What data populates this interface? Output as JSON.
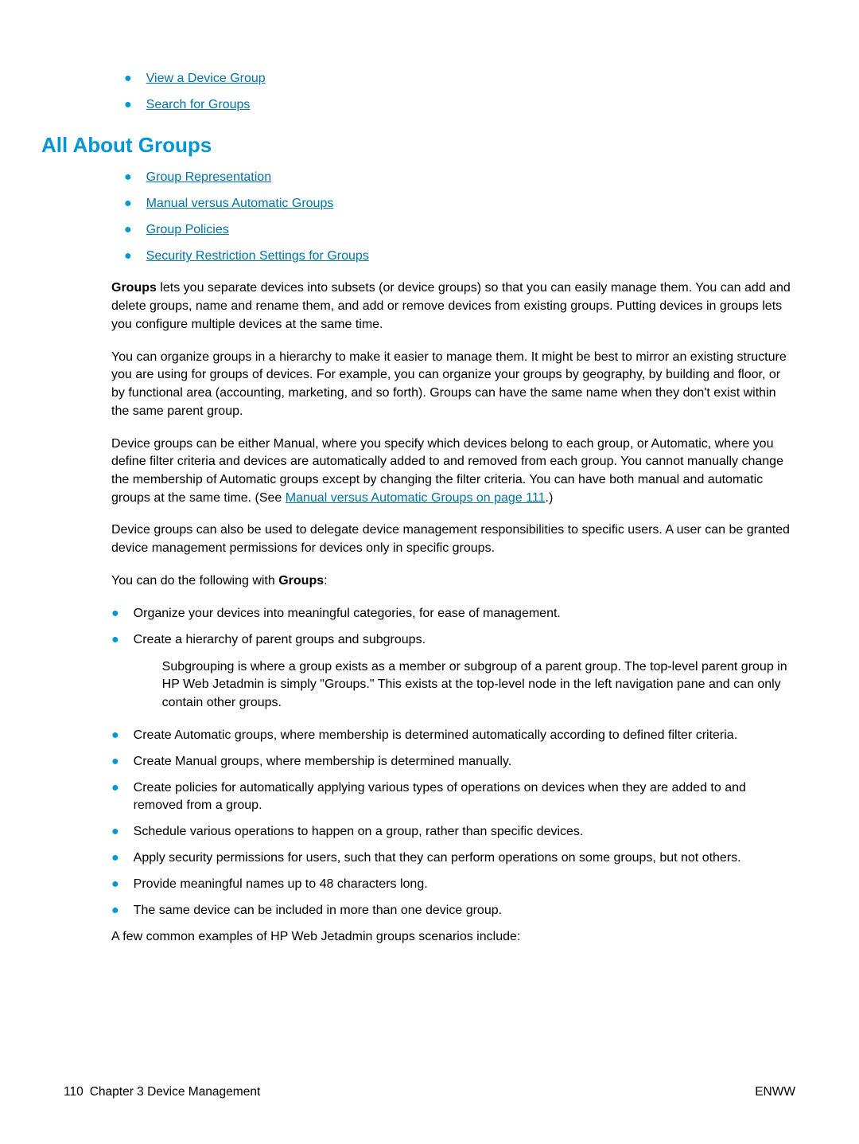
{
  "topLinks": [
    "View a Device Group",
    "Search for Groups"
  ],
  "heading": "All About Groups",
  "sectionLinks": [
    "Group Representation",
    "Manual versus Automatic Groups",
    "Group Policies",
    "Security Restriction Settings for Groups"
  ],
  "p1": {
    "boldLead": "Groups",
    "rest": " lets you separate devices into subsets (or device groups) so that you can easily manage them. You can add and delete groups, name and rename them, and add or remove devices from existing groups. Putting devices in groups lets you configure multiple devices at the same time."
  },
  "p2": "You can organize groups in a hierarchy to make it easier to manage them. It might be best to mirror an existing structure you are using for groups of devices. For example, you can organize your groups by geography, by building and floor, or by functional area (accounting, marketing, and so forth). Groups can have the same name when they don't exist within the same parent group.",
  "p3": {
    "pre": "Device groups can be either Manual, where you specify which devices belong to each group, or Automatic, where you define filter criteria and devices are automatically added to and removed from each group. You cannot manually change the membership of Automatic groups except by changing the filter criteria. You can have both manual and automatic groups at the same time. (See ",
    "link": "Manual versus Automatic Groups on page 111",
    "post": ".)"
  },
  "p4": "Device groups can also be used to delegate device management responsibilities to specific users. A user can be granted device management permissions for devices only in specific groups.",
  "p5": {
    "pre": "You can do the following with ",
    "bold": "Groups",
    "post": ":"
  },
  "bodyBullets": [
    {
      "text": "Organize your devices into meaningful categories, for ease of management."
    },
    {
      "text": "Create a hierarchy of parent groups and subgroups.",
      "sub": "Subgrouping is where a group exists as a member or subgroup of a parent group. The top-level parent group in HP Web Jetadmin is simply \"Groups.\" This exists at the top-level node in the left navigation pane and can only contain other groups."
    },
    {
      "text": "Create Automatic groups, where membership is determined automatically according to defined filter criteria."
    },
    {
      "text": "Create Manual groups, where membership is determined manually."
    },
    {
      "text": "Create policies for automatically applying various types of operations on devices when they are added to and removed from a group."
    },
    {
      "text": "Schedule various operations to happen on a group, rather than specific devices."
    },
    {
      "text": "Apply security permissions for users, such that they can perform operations on some groups, but not others."
    },
    {
      "text": "Provide meaningful names up to 48 characters long."
    },
    {
      "text": "The same device can be included in more than one device group."
    }
  ],
  "p6": "A few common examples of HP Web Jetadmin groups scenarios include:",
  "footer": {
    "pageNum": "110",
    "chapter": "Chapter 3   Device Management",
    "right": "ENWW"
  }
}
